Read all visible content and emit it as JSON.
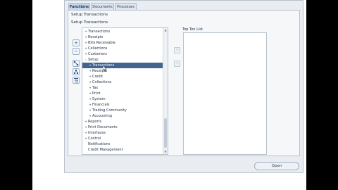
{
  "tabs": [
    {
      "label": "Functions",
      "active": true
    },
    {
      "label": "Documents",
      "active": false
    },
    {
      "label": "Processes",
      "active": false
    }
  ],
  "panel": {
    "title": "Setup Transactions",
    "subtitle": "Setup Transactions"
  },
  "tree": {
    "items": [
      {
        "label": "Transactions",
        "prefix": "+",
        "indent": 0,
        "selected": false
      },
      {
        "label": "Receipts",
        "prefix": "+",
        "indent": 0,
        "selected": false
      },
      {
        "label": "Bills Receivable",
        "prefix": "+",
        "indent": 0,
        "selected": false
      },
      {
        "label": "Collections",
        "prefix": "+",
        "indent": 0,
        "selected": false
      },
      {
        "label": "Customers",
        "prefix": "+",
        "indent": 0,
        "selected": false
      },
      {
        "label": "Setup",
        "prefix": "-",
        "indent": 0,
        "selected": false
      },
      {
        "label": "Transactions",
        "prefix": "+",
        "indent": 1,
        "selected": true
      },
      {
        "label": "Receipts",
        "prefix": "+",
        "indent": 1,
        "selected": false
      },
      {
        "label": "Credit",
        "prefix": "+",
        "indent": 1,
        "selected": false
      },
      {
        "label": "Collections",
        "prefix": "+",
        "indent": 1,
        "selected": false
      },
      {
        "label": "Tax",
        "prefix": "+",
        "indent": 1,
        "selected": false
      },
      {
        "label": "Print",
        "prefix": "+",
        "indent": 1,
        "selected": false
      },
      {
        "label": "System",
        "prefix": "+",
        "indent": 1,
        "selected": false
      },
      {
        "label": "Financials",
        "prefix": "+",
        "indent": 1,
        "selected": false
      },
      {
        "label": "Trading Community",
        "prefix": "+",
        "indent": 1,
        "selected": false
      },
      {
        "label": "Accounting",
        "prefix": "+",
        "indent": 1,
        "selected": false
      },
      {
        "label": "Reports",
        "prefix": "+",
        "indent": 0,
        "selected": false
      },
      {
        "label": "Print Documents",
        "prefix": "+",
        "indent": 0,
        "selected": false
      },
      {
        "label": "Interfaces",
        "prefix": "+",
        "indent": 0,
        "selected": false
      },
      {
        "label": "Control",
        "prefix": "+",
        "indent": 0,
        "selected": false
      },
      {
        "label": "Notifications",
        "prefix": "",
        "indent": 0,
        "selected": false
      },
      {
        "label": "Credit Management",
        "prefix": "",
        "indent": 0,
        "selected": false
      }
    ]
  },
  "top_ten": {
    "label": "Top Ten List"
  },
  "buttons": {
    "open_label": "Open",
    "add_symbol": "+",
    "remove_symbol": "−",
    "move_right": "»",
    "move_left": "«"
  },
  "colors": {
    "selection": "#43648f",
    "background": "#e9edf1",
    "accent": "#2a5a9a"
  }
}
